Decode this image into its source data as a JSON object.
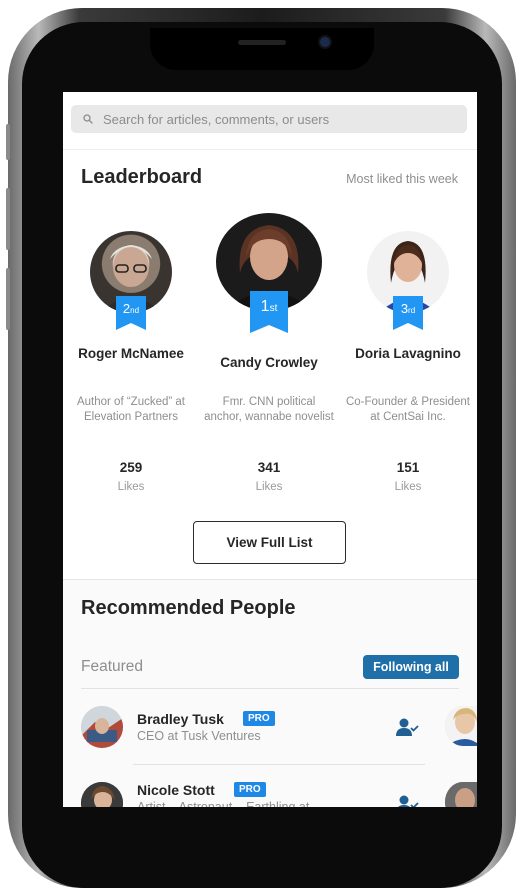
{
  "search": {
    "placeholder": "Search for articles, comments, or users",
    "icon": "search-icon"
  },
  "leaderboard": {
    "title": "Leaderboard",
    "subtitle": "Most liked this week",
    "ranks": [
      {
        "rank_number": "2",
        "rank_suffix": "nd",
        "name": "Roger McNamee",
        "role": "Author of “Zucked” at Elevation Partners",
        "likes": "259",
        "likes_label": "Likes"
      },
      {
        "rank_number": "1",
        "rank_suffix": "st",
        "name": "Candy Crowley",
        "role": "Fmr. CNN political anchor, wannabe novelist",
        "likes": "341",
        "likes_label": "Likes"
      },
      {
        "rank_number": "3",
        "rank_suffix": "rd",
        "name": "Doria Lavagnino",
        "role": "Co-Founder & President at CentSai Inc.",
        "likes": "151",
        "likes_label": "Likes"
      }
    ],
    "view_full_list": "View Full List"
  },
  "recommended": {
    "title": "Recommended People",
    "featured_label": "Featured",
    "following_all_label": "Following all",
    "people": [
      {
        "name": "Bradley Tusk",
        "badge": "PRO",
        "role": "CEO at Tusk Ventures"
      },
      {
        "name": "Nicole Stott",
        "badge": "PRO",
        "role": "Artist – Astronaut – Earthling at"
      }
    ]
  },
  "colors": {
    "accent_blue": "#2196f3",
    "button_dark_blue": "#1f6fa8",
    "pro_badge": "#1e88e5",
    "text_dark": "#262626",
    "text_muted": "#8e8e8e"
  }
}
